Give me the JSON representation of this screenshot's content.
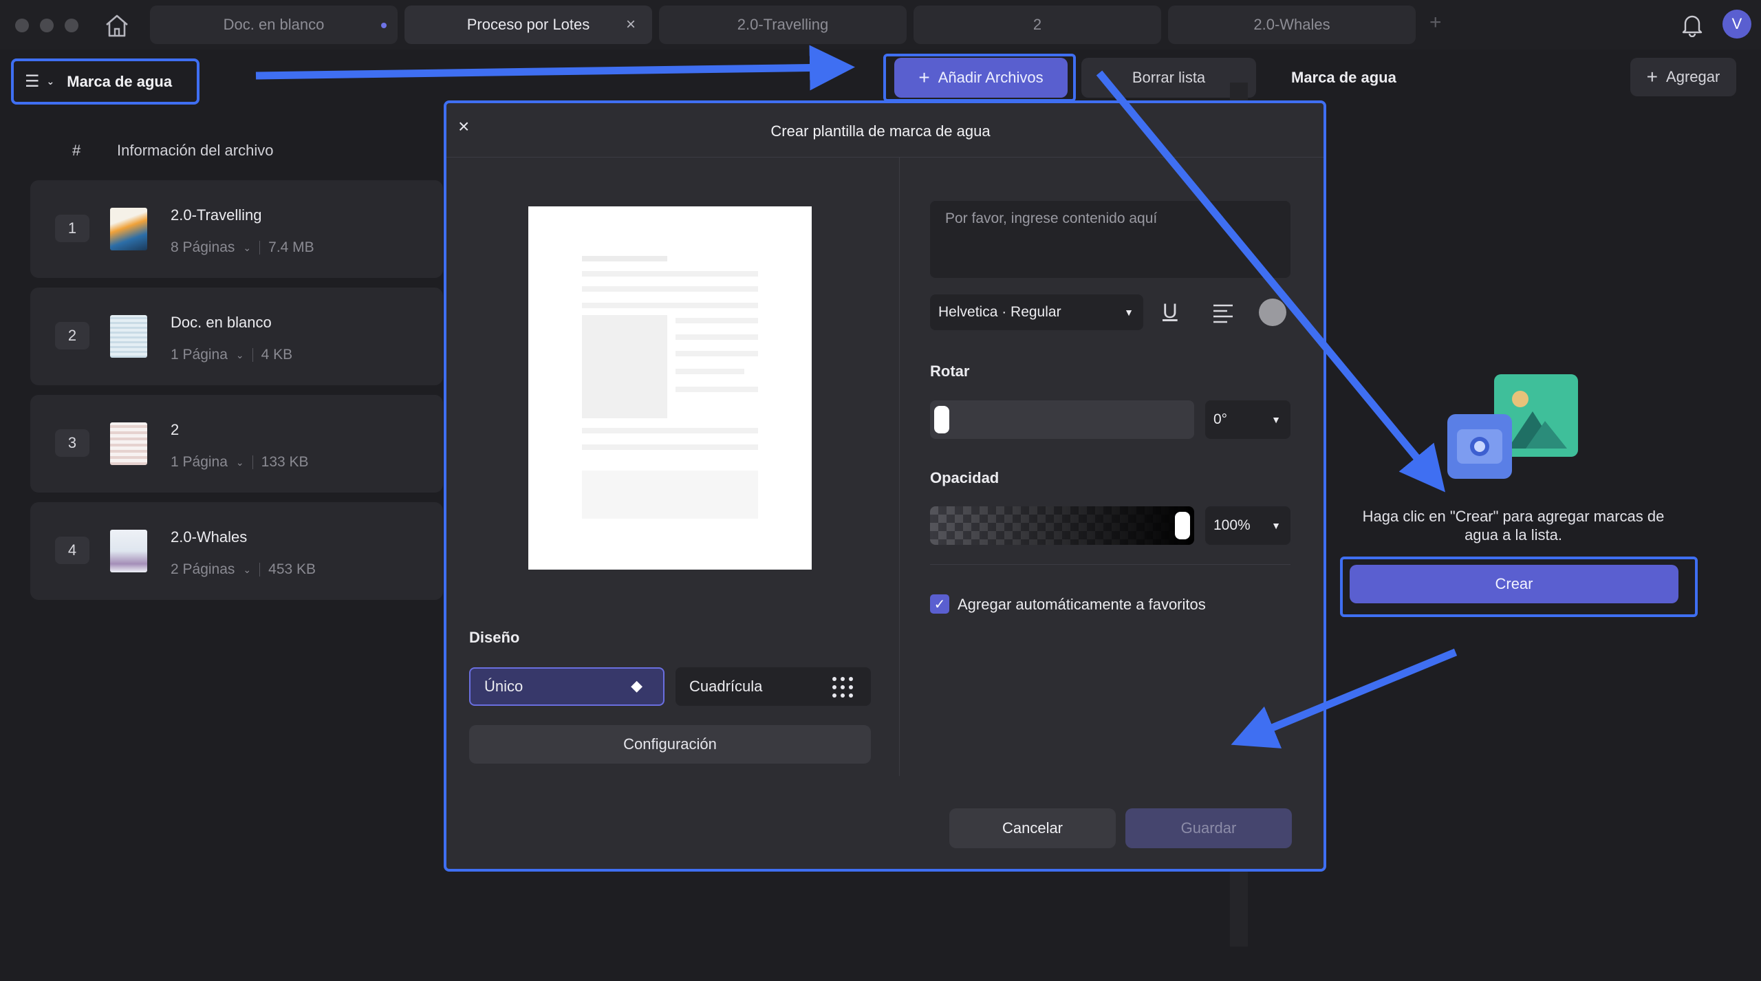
{
  "tabs": [
    {
      "label": "Doc. en blanco"
    },
    {
      "label": "Proceso por Lotes"
    },
    {
      "label": "2.0-Travelling"
    },
    {
      "label": "2"
    },
    {
      "label": "2.0-Whales"
    }
  ],
  "avatar_letter": "V",
  "toolbar": {
    "mode_label": "Marca de agua",
    "add_files": "Añadir Archivos",
    "clear_list": "Borrar lista",
    "panel_title": "Marca de agua",
    "add": "Agregar"
  },
  "list": {
    "col_num": "#",
    "col_info": "Información del archivo",
    "files": [
      {
        "num": "1",
        "name": "2.0-Travelling",
        "pages": "8 Páginas",
        "size": "7.4 MB"
      },
      {
        "num": "2",
        "name": "Doc. en blanco",
        "pages": "1 Página",
        "size": "4 KB"
      },
      {
        "num": "3",
        "name": "2",
        "pages": "1 Página",
        "size": "133 KB"
      },
      {
        "num": "4",
        "name": "2.0-Whales",
        "pages": "2 Páginas",
        "size": "453 KB"
      }
    ]
  },
  "modal": {
    "close": "×",
    "title": "Crear plantilla de marca de agua",
    "content_placeholder": "Por favor, ingrese contenido aquí",
    "font": "Helvetica · Regular",
    "rotate_label": "Rotar",
    "rotate_value": "0°",
    "opacity_label": "Opacidad",
    "opacity_value": "100%",
    "opacity_level": 1.0,
    "auto_favorites": "Agregar automáticamente a favoritos",
    "auto_favorites_checked": true,
    "design_label": "Diseño",
    "design_single": "Único",
    "design_grid": "Cuadrícula",
    "config": "Configuración",
    "cancel": "Cancelar",
    "save": "Guardar"
  },
  "empty_state": {
    "message": "Haga clic en \"Crear\" para agregar marcas de agua a la lista.",
    "create": "Crear"
  },
  "colors": {
    "accent": "#5a5fd0",
    "highlight": "#3f6ff2",
    "background": "#1e1e22"
  }
}
